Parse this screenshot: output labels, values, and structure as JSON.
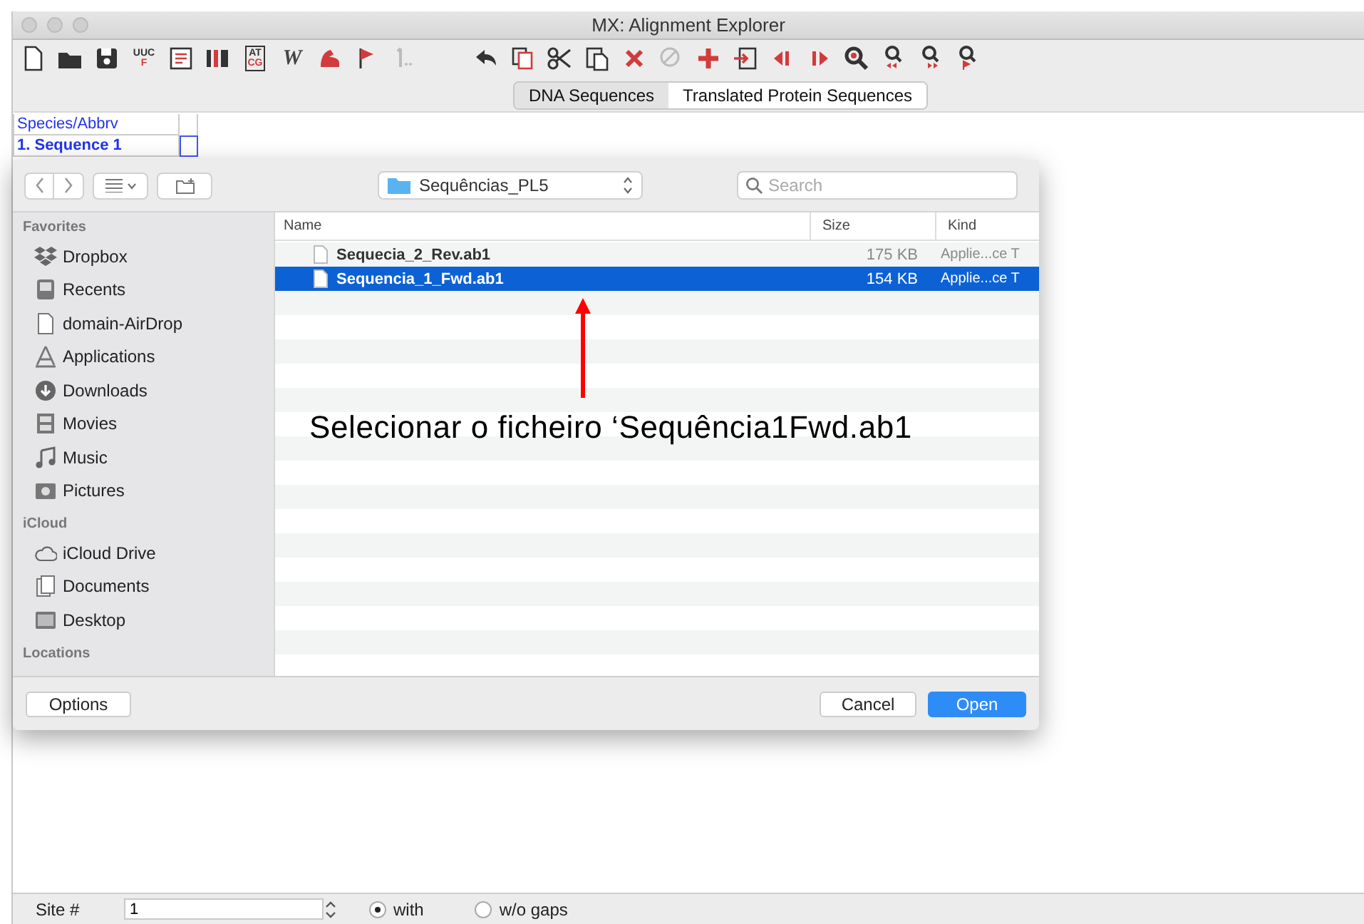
{
  "window": {
    "title": "MX: Alignment Explorer"
  },
  "toolbar": {
    "icon_texts": {
      "codon_top": "UUC",
      "codon_bottom": "F",
      "nucleotide_top": "AT",
      "nucleotide_bottom": "CG",
      "italic_letter": "W"
    }
  },
  "tabs": [
    {
      "label": "DNA Sequences",
      "selected": false
    },
    {
      "label": "Translated Protein Sequences",
      "selected": true
    }
  ],
  "sequence_grid": {
    "header": "Species/Abbrv",
    "rows": [
      {
        "label": "1. Sequence 1",
        "selected": true
      }
    ]
  },
  "dialog": {
    "location": "Sequências_PL5",
    "search": {
      "placeholder": "Search"
    },
    "sidebar": [
      {
        "heading": "Favorites",
        "items": [
          {
            "label": "Dropbox",
            "kind": "dropbox"
          },
          {
            "label": "Recents",
            "kind": "recents"
          },
          {
            "label": "domain-AirDrop",
            "kind": "file"
          },
          {
            "label": "Applications",
            "kind": "apps"
          },
          {
            "label": "Downloads",
            "kind": "downloads"
          },
          {
            "label": "Movies",
            "kind": "movies"
          },
          {
            "label": "Music",
            "kind": "music"
          },
          {
            "label": "Pictures",
            "kind": "pictures"
          }
        ]
      },
      {
        "heading": "iCloud",
        "items": [
          {
            "label": "iCloud Drive",
            "kind": "cloud"
          },
          {
            "label": "Documents",
            "kind": "documents"
          },
          {
            "label": "Desktop",
            "kind": "desktop"
          }
        ]
      },
      {
        "heading": "Locations"
      }
    ],
    "columns": [
      "Name",
      "Size",
      "Kind"
    ],
    "files": [
      {
        "name": "Sequecia_2_Rev.ab1",
        "size": "175 KB",
        "kind": "Applie...ce T",
        "selected": false
      },
      {
        "name": "Sequencia_1_Fwd.ab1",
        "size": "154 KB",
        "kind": "Applie...ce T",
        "selected": true
      }
    ],
    "buttons": {
      "options": "Options",
      "cancel": "Cancel",
      "open": "Open"
    }
  },
  "annotation": {
    "text": "Selecionar o ficheiro ‘Sequência1Fwd.ab1"
  },
  "status_bar": {
    "site_label": "Site #",
    "site_value": "1",
    "radios": [
      {
        "label": "with",
        "selected": true
      },
      {
        "label": "w/o gaps",
        "selected": false
      }
    ]
  }
}
